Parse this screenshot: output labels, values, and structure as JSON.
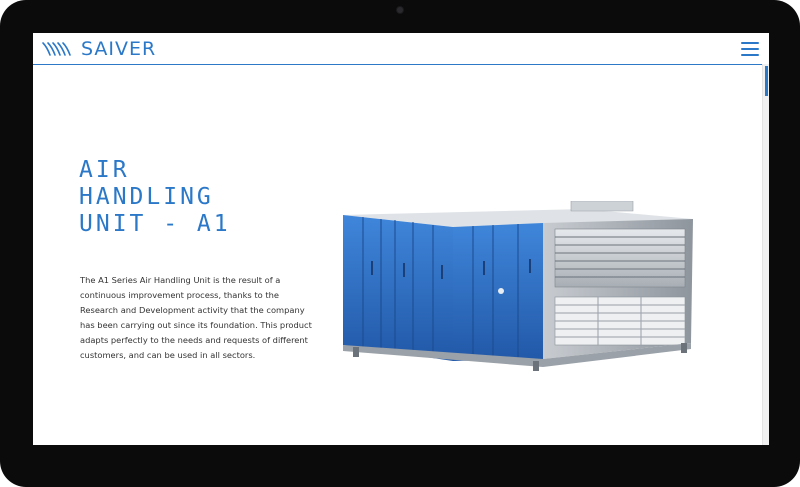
{
  "brand": {
    "name": "SAIVER",
    "color": "#2b78c8"
  },
  "header": {
    "menu_icon": "hamburger-menu-icon"
  },
  "hero": {
    "title_lines": [
      "AIR",
      "HANDLING",
      "UNIT - A1"
    ],
    "description": "The A1 Series Air Handling Unit is the result of a continuous improvement process, thanks to the Research and Development activity that the company has been carrying out since its foundation. This product adapts perfectly to the needs and requests of different customers, and can be used in all sectors."
  },
  "colors": {
    "accent": "#2b78c8",
    "unit_blue": "#2f6fc9",
    "frame": "#0b0b0c"
  }
}
